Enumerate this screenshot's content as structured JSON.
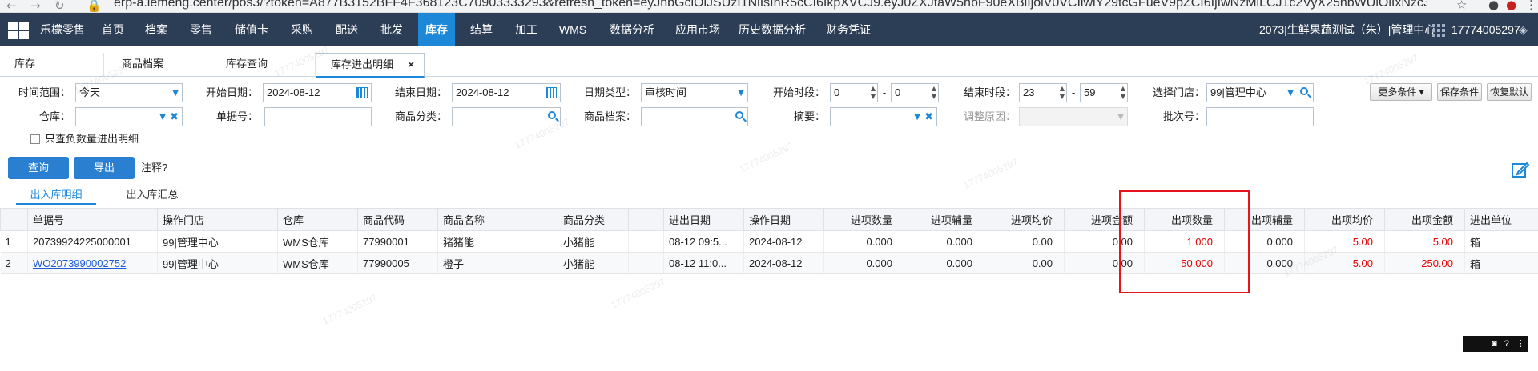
{
  "browser": {
    "url": "erp-a.lemeng.center/pos3/?token=A877B3152BFF4F368123C70903333293&refresh_token=eyJhbGciOiJSUzI1NiIsInR5cCI6IkpXVCJ9.eyJ0ZXJtaW5hbF90eXBlIjoiV0VCIiwiY29tcGFueV9pZCI6IjIwNzMiLCJ1c2VyX25hbWUiOiIxNzc3NDAwNTI5NyIsImNvb...",
    "icons": {
      "back": "←",
      "forward": "→",
      "reload": "↻",
      "star": "☆",
      "profile": "●",
      "alert": "●",
      "menu": "⋮"
    }
  },
  "topnav": {
    "items": [
      "乐檬零售",
      "首页",
      "档案",
      "零售",
      "储值卡",
      "采购",
      "配送",
      "批发",
      "库存",
      "结算",
      "加工",
      "WMS",
      "数据分析",
      "应用市场",
      "历史数据分析",
      "财务凭证"
    ],
    "active": "库存",
    "store_user": "2073|生鲜果蔬测试（朱）|管理中心",
    "account": "17774005297",
    "pin": "◈",
    "active_color": "#1e88d8",
    "bg_color": "#2c3e56"
  },
  "subtabs": [
    "库存",
    "商品档案",
    "库存查询",
    "库存进出明细"
  ],
  "subtab_close": "×",
  "filters": {
    "time_range_label": "时间范围：",
    "time_range_value": "今天",
    "start_date_label": "开始日期：",
    "start_date_value": "2024-08-12",
    "end_date_label": "结束日期：",
    "end_date_value": "2024-08-12",
    "date_type_label": "日期类型：",
    "date_type_value": "审核时间",
    "start_slot_label": "开始时段：",
    "start_slot_h": "0",
    "start_slot_m": "0",
    "end_slot_label": "结束时段：",
    "end_slot_h": "23",
    "end_slot_m": "59",
    "slot_sep": "-",
    "store_label": "选择门店：",
    "store_value": "99|管理中心",
    "warehouse_label": "仓库：",
    "doc_no_label": "单据号：",
    "category_label": "商品分类：",
    "product_label": "商品档案：",
    "summary_label": "摘要：",
    "adjust_reason_label": "调整原因：",
    "batch_label": "批次号：",
    "negative_only_label": "只查负数量进出明细"
  },
  "right_buttons": [
    "更多条件 ▾",
    "保存条件",
    "恢复默认"
  ],
  "actions": {
    "query": "查询",
    "export": "导出",
    "note": "注释?"
  },
  "inner_tabs": [
    "出入库明细",
    "出入库汇总"
  ],
  "table": {
    "columns": [
      "",
      "单据号",
      "操作门店",
      "仓库",
      "商品代码",
      "商品名称",
      "商品分类",
      "",
      "进出日期",
      "操作日期",
      "进项数量",
      "进项辅量",
      "进项均价",
      "进项金额",
      "出项数量",
      "出项辅量",
      "出项均价",
      "出项金额",
      "进出单位"
    ],
    "rows": [
      [
        "1",
        "20739924225000001",
        "99|管理中心",
        "WMS仓库",
        "77990001",
        "猪猪能",
        "小猪能",
        "",
        "08-12 09:5...",
        "2024-08-12",
        "0.000",
        "0.000",
        "0.00",
        "0.00",
        "1.000",
        "0.000",
        "5.00",
        "5.00",
        "箱"
      ],
      [
        "2",
        "WO2073990002752",
        "99|管理中心",
        "WMS仓库",
        "77990005",
        "橙子",
        "小猪能",
        "",
        "08-12 11:0...",
        "2024-08-12",
        "0.000",
        "0.000",
        "0.00",
        "0.00",
        "50.000",
        "0.000",
        "5.00",
        "250.00",
        "箱"
      ]
    ],
    "red_color": "#e60000"
  },
  "watermark": "17774005297",
  "tray": {
    "icons": [
      "◙",
      "?",
      "⋮"
    ]
  }
}
